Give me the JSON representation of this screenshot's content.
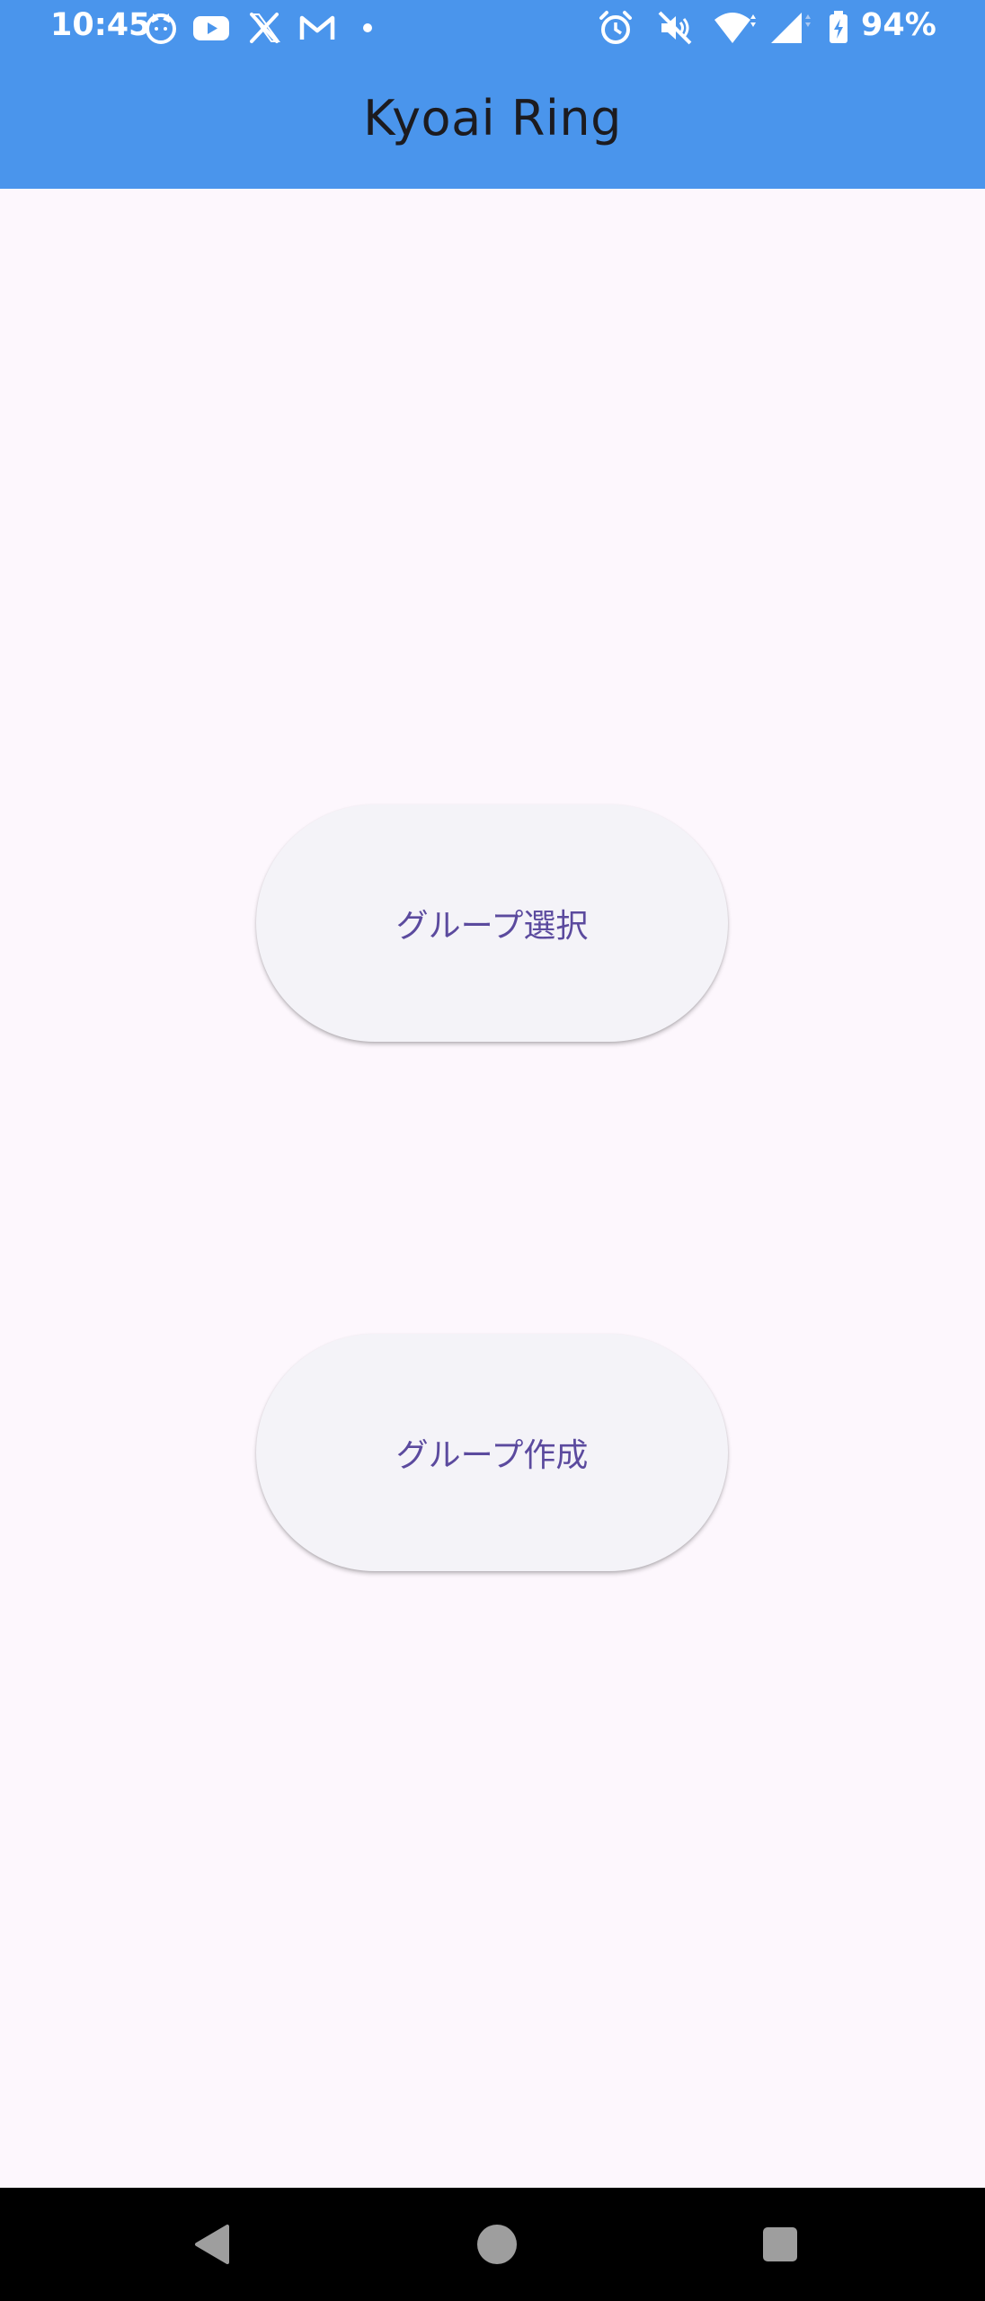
{
  "status_bar": {
    "time": "10:45",
    "battery": "94%",
    "notification_icons": [
      "cat-app-icon",
      "youtube-icon",
      "x-icon",
      "gmail-icon",
      "dot-icon"
    ],
    "system_icons": [
      "alarm-icon",
      "mute-icon",
      "wifi-icon",
      "signal-icon",
      "battery-icon"
    ]
  },
  "app_bar": {
    "title": "Kyoai Ring"
  },
  "main": {
    "buttons": [
      {
        "label": "グループ選択"
      },
      {
        "label": "グループ作成"
      }
    ]
  },
  "nav_bar": {
    "buttons": [
      "back-icon",
      "home-icon",
      "recents-icon"
    ]
  },
  "colors": {
    "app_bar": "#4a95ec",
    "background": "#fdf7fd",
    "button_bg": "#f4f3f8",
    "button_text": "#5b4a9e",
    "nav_bar": "#000000"
  }
}
